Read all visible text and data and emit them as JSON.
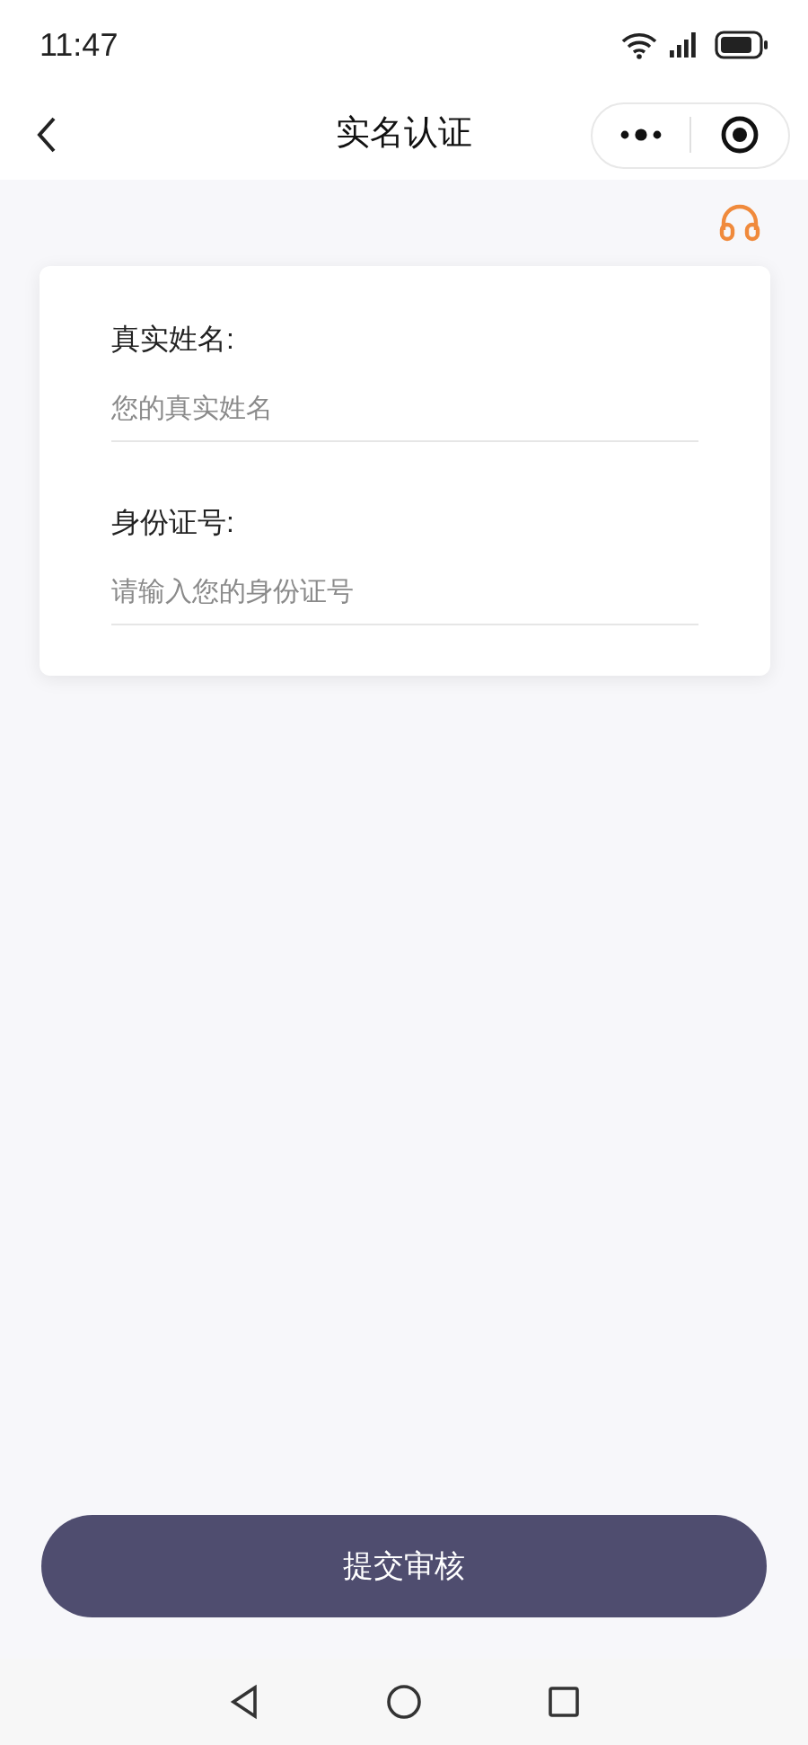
{
  "status_bar": {
    "time": "11:47"
  },
  "header": {
    "title": "实名认证"
  },
  "form": {
    "fields": [
      {
        "label": "真实姓名:",
        "placeholder": "您的真实姓名"
      },
      {
        "label": "身份证号:",
        "placeholder": "请输入您的身份证号"
      }
    ]
  },
  "submit_button": {
    "label": "提交审核"
  }
}
